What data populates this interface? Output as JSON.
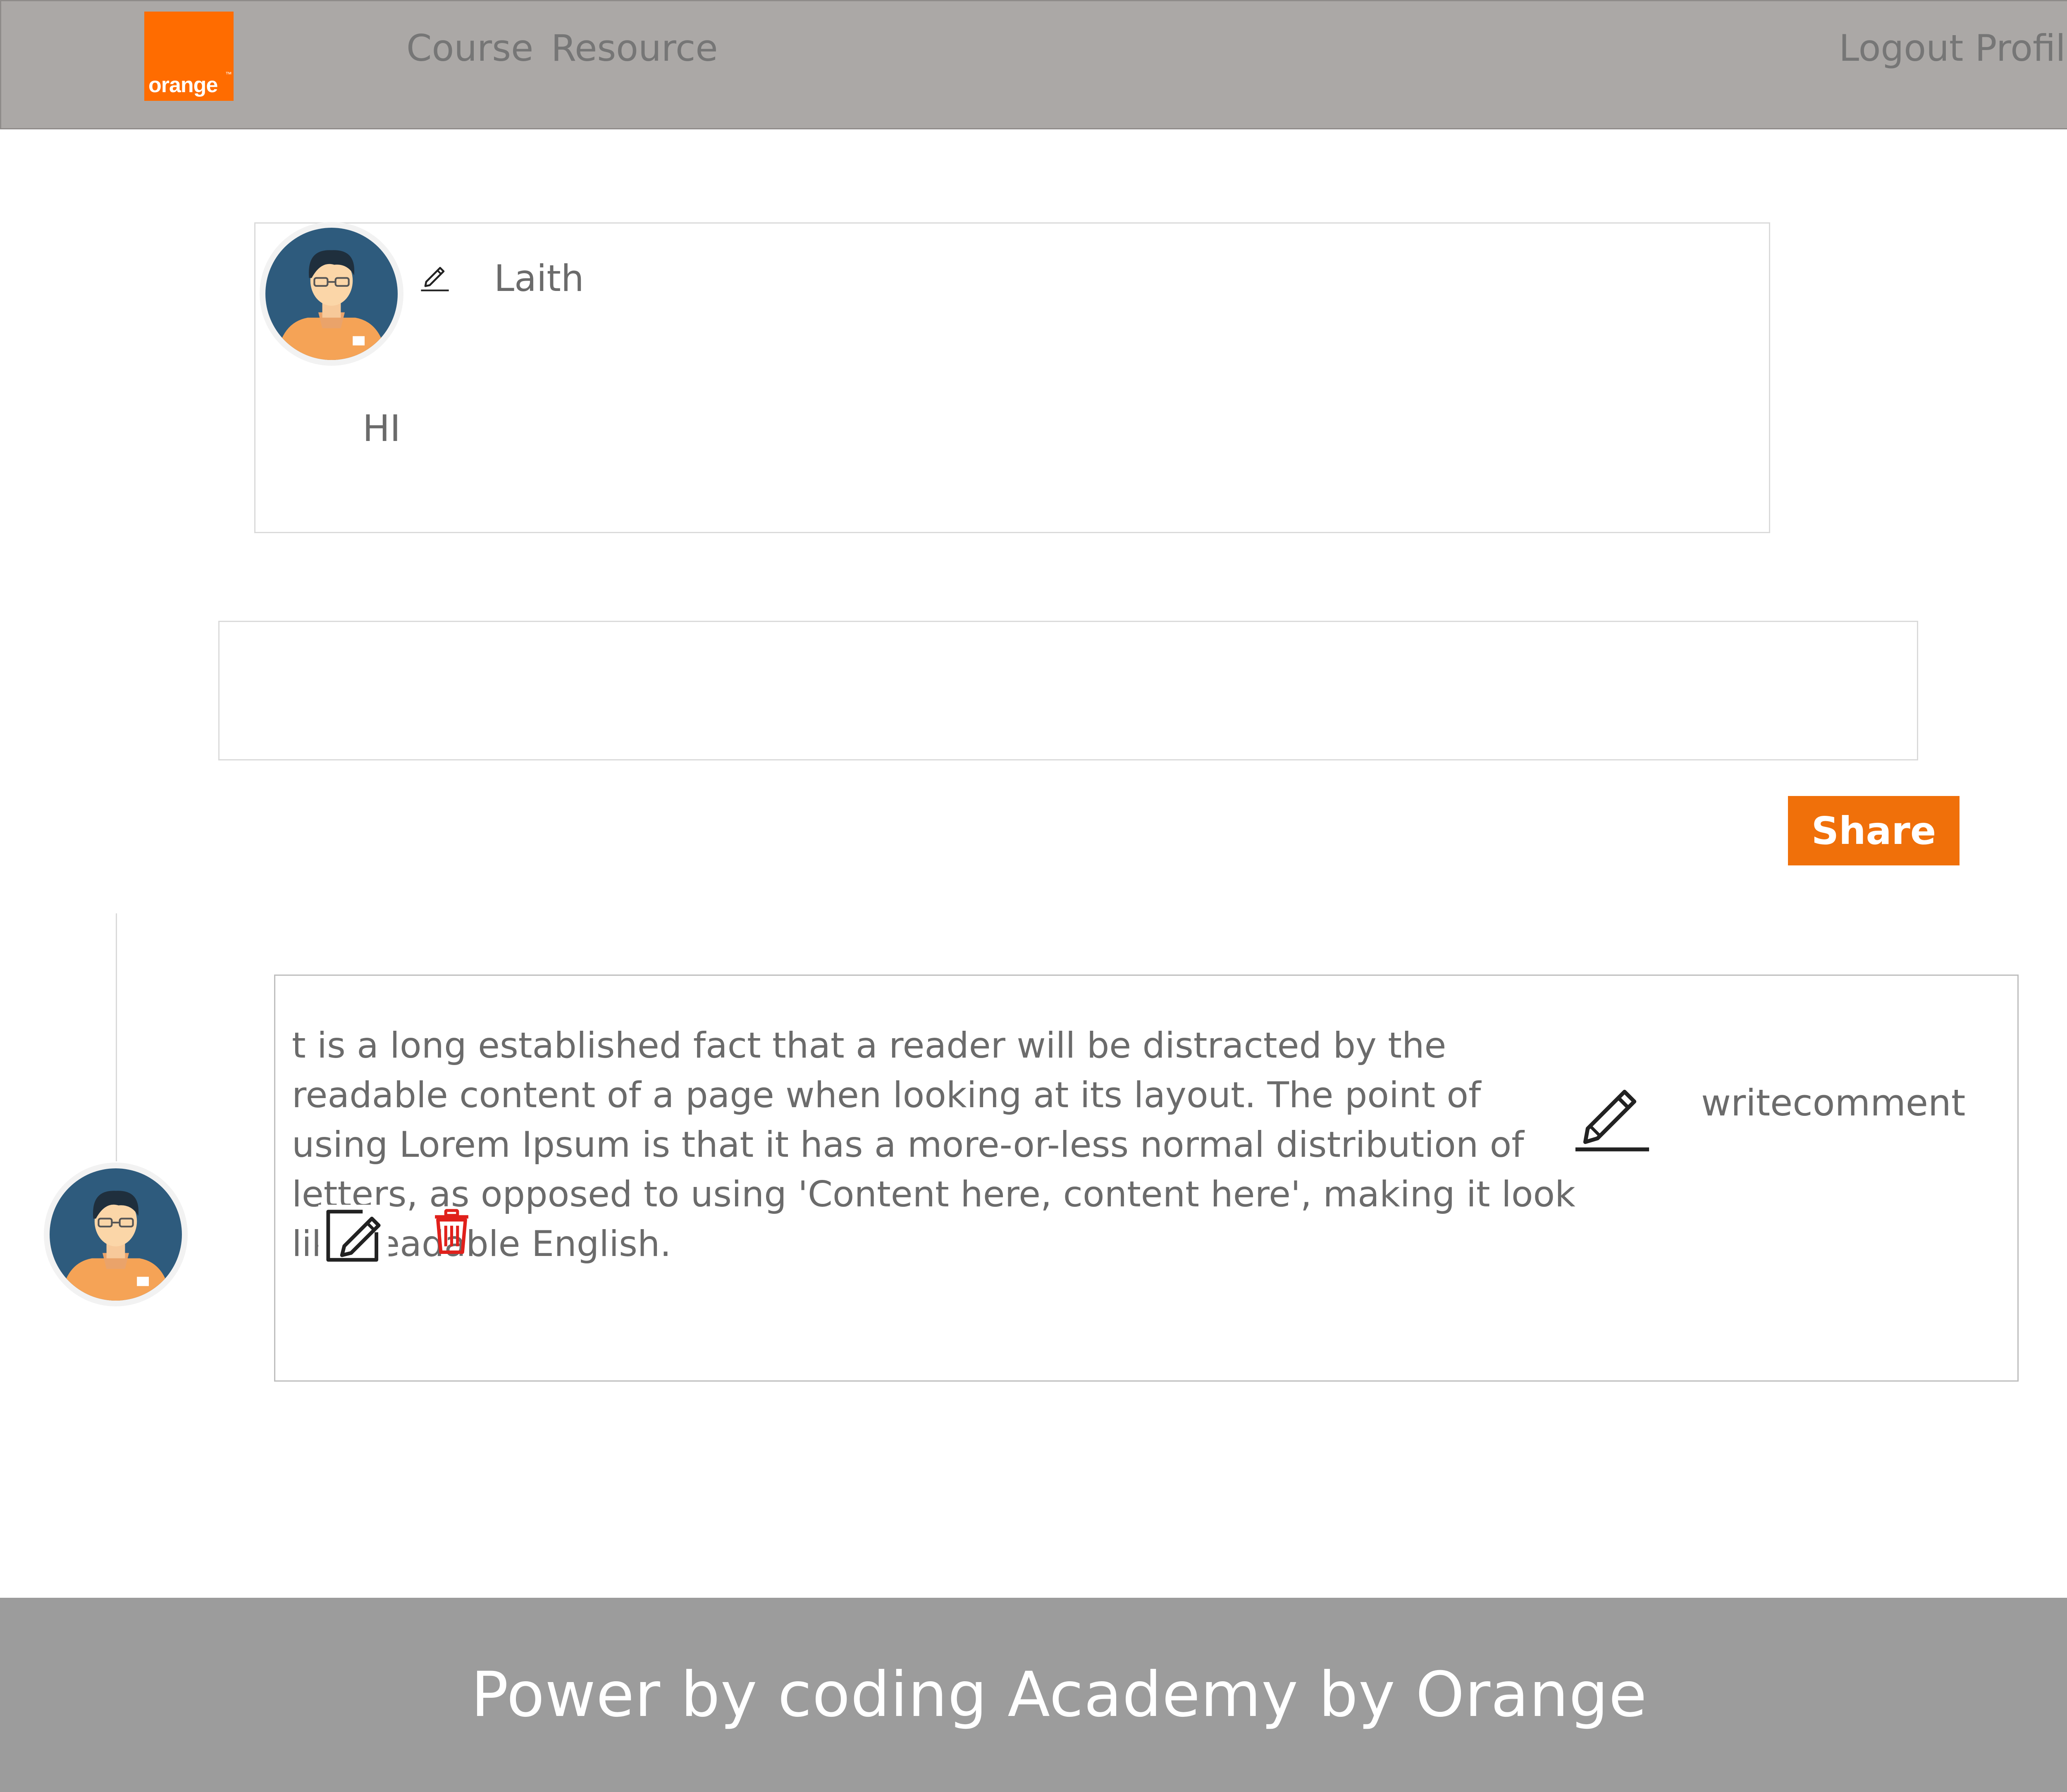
{
  "header": {
    "logo_text": "orange",
    "logo_trademark": "™",
    "nav_items": [
      "Course",
      "Resource"
    ],
    "right_links": [
      "Logout",
      "Profile"
    ]
  },
  "post": {
    "author": "Laith",
    "body": "HI",
    "edit_icon": "pencil-icon",
    "avatar_icon": "user-avatar"
  },
  "comment_form": {
    "input_value": "",
    "share_label": "Share"
  },
  "comment": {
    "text": "t is a long established fact that a reader will be distracted by the readable content of a page when looking at its layout. The point of using Lorem Ipsum is that it has a more-or-less normal distribution of letters, as opposed to using 'Content here, content here', making it look like readable English.",
    "write_label": "writecomment",
    "write_icon": "pencil-icon",
    "edit_icon": "edit-square-icon",
    "delete_icon": "trash-icon",
    "delete_color": "#e0201b"
  },
  "footer": {
    "text": "Power by coding Academy by Orange"
  },
  "colors": {
    "header_bg": "#aba8a6",
    "brand_orange": "#ff6c00",
    "share_bg": "#f0700a",
    "footer_bg": "#9c9c9c"
  }
}
